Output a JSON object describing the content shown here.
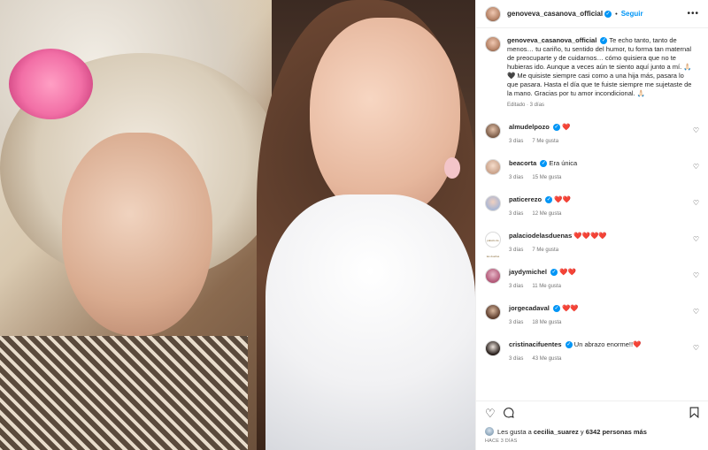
{
  "post": {
    "username": "genoveva_casanova_official",
    "follow_label": "Seguir",
    "more_label": "•••",
    "caption_text": "Te echo tanto, tanto de menos… tu cariño, tu sentido del humor, tu forma tan maternal de preocuparte y de cuidarnos… cómo quisiera que no te hubieras ido. Aunque a veces aún te siento aquí junto a mí. 🙏🏻🖤 Me quisiste siempre casi como a una hija más, pasara lo que pasara. Hasta el día que te fuiste siempre me sujetaste de la mano. Gracias por tu amor incondicional. 🙏🏻",
    "caption_meta": "Editado · 3 días"
  },
  "comments": [
    {
      "username": "almudelpozo",
      "verified": true,
      "text": "❤️",
      "time": "3 días",
      "likes": "7 Me gusta"
    },
    {
      "username": "beacorta",
      "verified": true,
      "text": "Era única",
      "time": "3 días",
      "likes": "15 Me gusta"
    },
    {
      "username": "paticerezo",
      "verified": true,
      "text": "❤️❤️",
      "time": "3 días",
      "likes": "12 Me gusta"
    },
    {
      "username": "palaciodelasduenas",
      "verified": false,
      "text": "❤️❤️❤️❤️",
      "time": "3 días",
      "likes": "7 Me gusta"
    },
    {
      "username": "jaydymichel",
      "verified": true,
      "text": "❤️❤️",
      "time": "3 días",
      "likes": "11 Me gusta"
    },
    {
      "username": "jorgecadaval",
      "verified": true,
      "text": "❤️❤️",
      "time": "3 días",
      "likes": "18 Me gusta"
    },
    {
      "username": "cristinacifuentes",
      "verified": true,
      "text": "Un abrazo enorme!!❤️",
      "time": "3 días",
      "likes": "43 Me gusta"
    }
  ],
  "actions": {
    "like_icon": "heart-icon",
    "comment_icon": "comment-icon",
    "bookmark_icon": "bookmark-icon",
    "likes_prefix": "Les gusta a",
    "likes_user": "cecilia_suarez",
    "likes_middle": "y",
    "likes_count": "6342 personas más",
    "posted_when": "HACE 3 DÍAS"
  },
  "palace_logo_text": "palacio de las dueñas",
  "colors": {
    "accent": "#0095f6",
    "heart_red": "#e0263b",
    "muted": "#737373"
  }
}
